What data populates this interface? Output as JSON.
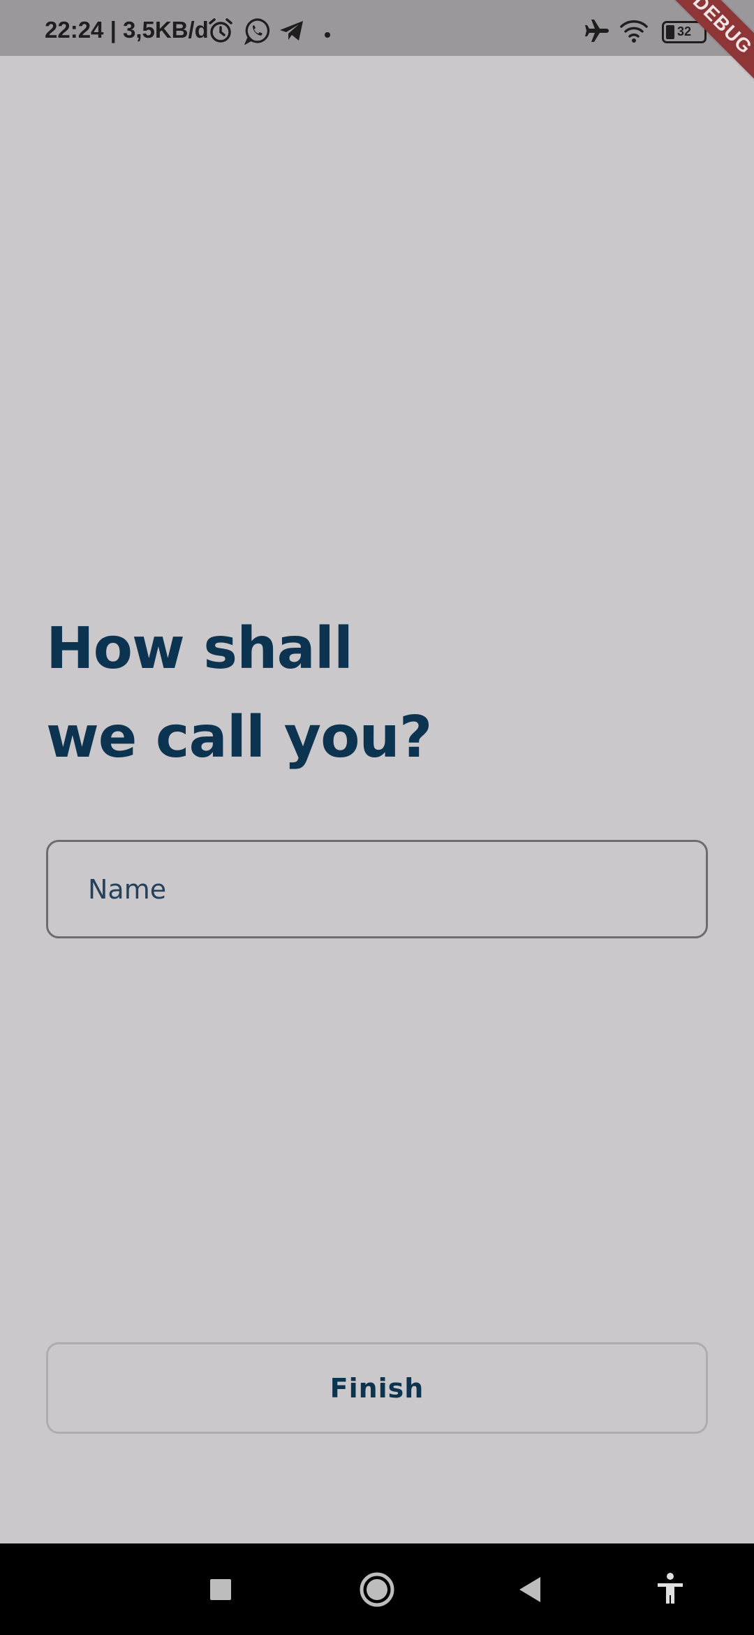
{
  "status_bar": {
    "time_text": "22:24 | 3,5KB/d",
    "battery_level_text": "32",
    "icons": [
      "alarm-icon",
      "whatsapp-icon",
      "telegram-icon",
      "notification-dot",
      "airplane-mode-icon",
      "wifi-icon",
      "battery-icon"
    ]
  },
  "debug_banner": {
    "label": "DEBUG"
  },
  "main": {
    "heading_line1": "How shall",
    "heading_line2": "we call you?",
    "name_placeholder": "Name",
    "name_value": "",
    "finish_label": "Finish"
  },
  "nav_bar": {
    "icons": [
      "recents-square-icon",
      "home-circle-icon",
      "back-triangle-icon",
      "accessibility-icon"
    ]
  },
  "colors": {
    "background": "#cac8cb",
    "status_bar": "#9a989b",
    "heading": "#0c3350",
    "field_border": "#6c6b6e",
    "button_border": "#aeacaf",
    "debug_banner": "#8e3537",
    "nav_bar": "#000000"
  }
}
